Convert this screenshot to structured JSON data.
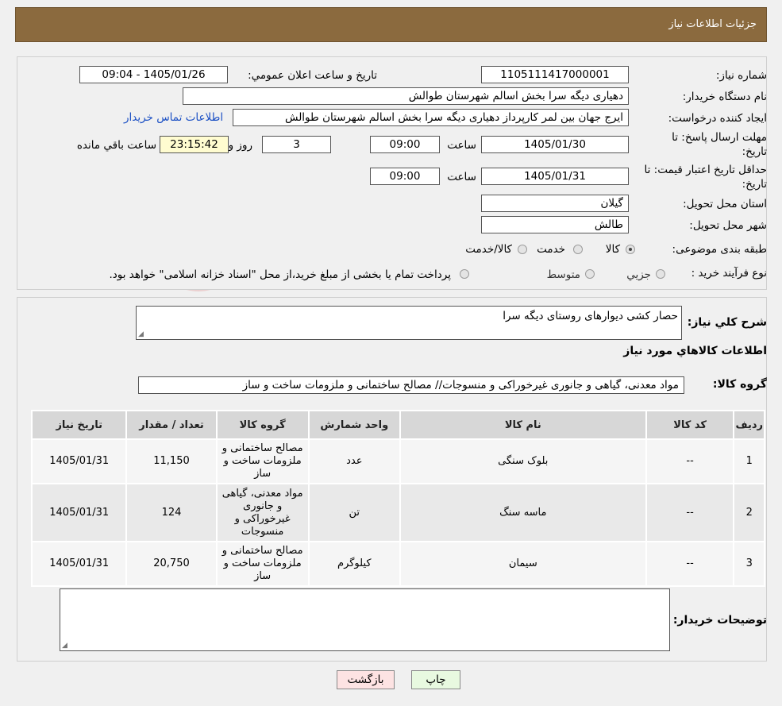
{
  "header": {
    "title": "جزئیات اطلاعات نیاز"
  },
  "form": {
    "need_number_label": "شماره نیاز:",
    "need_number": "1105111417000001",
    "announce_label": "تاریخ و ساعت اعلان عمومي:",
    "announce_value": "1405/01/26 - 09:04",
    "buyer_org_label": "نام دستگاه خریدار:",
    "buyer_org": "دهیاری دیگه سرا بخش اسالم شهرستان طوالش",
    "creator_label": "ایجاد کننده درخواست:",
    "creator": "ایرج جهان بین لمر کارپرداز دهیاری دیگه سرا بخش اسالم شهرستان طوالش",
    "contact_link": "اطلاعات تماس خریدار",
    "deadline_label_1": "مهلت ارسال پاسخ: تا",
    "deadline_label_2": "تاریخ:",
    "deadline_date": "1405/01/30",
    "time_label": "ساعت",
    "deadline_time": "09:00",
    "days_value": "3",
    "days_label": "روز و",
    "remaining_time": "23:15:42",
    "remaining_label": "ساعت باقي مانده",
    "validity_label_1": "حداقل تاریخ اعتبار قیمت: تا",
    "validity_label_2": "تاریخ:",
    "validity_date": "1405/01/31",
    "validity_time": "09:00",
    "province_label": "استان محل تحویل:",
    "province": "گیلان",
    "city_label": "شهر محل تحویل:",
    "city": "طالش",
    "category_label": "طبقه بندی موضوعی:",
    "category_options": [
      "کالا",
      "خدمت",
      "کالا/خدمت"
    ],
    "process_label": "نوع فرآیند خرید :",
    "process_options": [
      "جزيي",
      "متوسط"
    ],
    "process_note": "پرداخت تمام یا بخشی از مبلغ خرید،از محل \"اسناد خزانه اسلامی\" خواهد بود."
  },
  "details": {
    "summary_label": "شرح كلي نیاز:",
    "summary": "حصار کشی دیوارهای روستای دیگه سرا",
    "goods_info_title": "اطلاعات كالاهاي مورد نياز",
    "group_label": "گروه كالا:",
    "group_value": "مواد معدنی، گیاهی و جانوری غیرخوراکی و منسوجات// مصالح ساختمانی و ملزومات ساخت و ساز",
    "table": {
      "headers": [
        "رديف",
        "کد کالا",
        "نام كالا",
        "واحد شمارش",
        "گروه کالا",
        "تعداد / مقدار",
        "تاریخ نیاز"
      ],
      "rows": [
        [
          "1",
          "--",
          "بلوک سنگی",
          "عدد",
          "مصالح ساختمانی و ملزومات ساخت و ساز",
          "11,150",
          "1405/01/31"
        ],
        [
          "2",
          "--",
          "ماسه سنگ",
          "تن",
          "مواد معدنی، گیاهی و جانوری غیرخوراکی و منسوجات",
          "124",
          "1405/01/31"
        ],
        [
          "3",
          "--",
          "سیمان",
          "کیلوگرم",
          "مصالح ساختمانی و ملزومات ساخت و ساز",
          "20,750",
          "1405/01/31"
        ]
      ]
    },
    "buyer_notes_label": "توضیحات خریدار:",
    "buyer_notes": ""
  },
  "buttons": {
    "print": "چاپ",
    "back": "بازگشت"
  },
  "colors": {
    "header_bg": "#8b6a3e",
    "link": "#1a4fc4",
    "back_btn_bg": "#fde3e3",
    "print_btn_bg": "#e8f9e0"
  }
}
